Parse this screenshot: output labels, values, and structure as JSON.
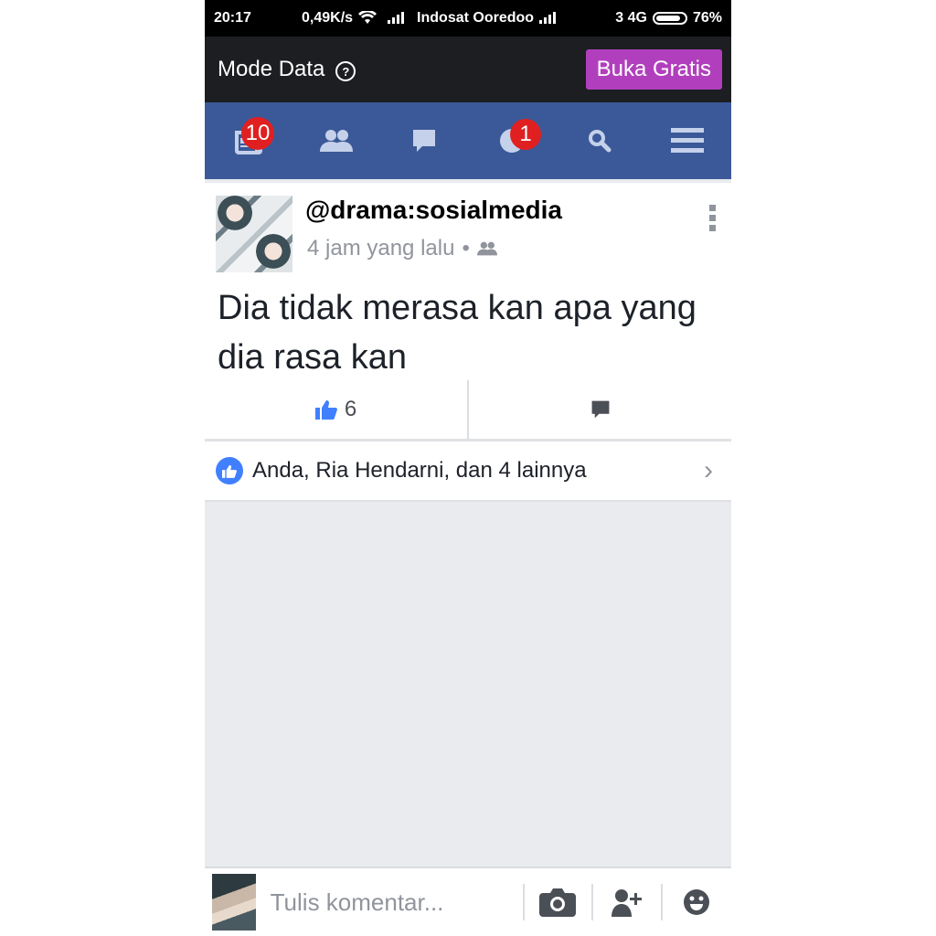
{
  "status_bar": {
    "time": "20:17",
    "speed": "0,49K/s",
    "carrier": "Indosat Ooredoo",
    "network": "3 4G",
    "battery": "76%"
  },
  "mode_bar": {
    "title": "Mode Data",
    "help_glyph": "?",
    "free_button": "Buka Gratis"
  },
  "nav": {
    "news_badge": "10",
    "notifications_badge": "1"
  },
  "post": {
    "author": "@drama:sosialmedia",
    "time": "4 jam yang lalu",
    "separator": "•",
    "text": "Dia tidak merasa kan apa yang dia rasa kan",
    "likes_count": "6"
  },
  "likes_row": {
    "text": "Anda, Ria Hendarni, dan 4 lainnya",
    "chevron": "›"
  },
  "comment_bar": {
    "placeholder": "Tulis komentar..."
  },
  "colors": {
    "fb_blue": "#3b5998",
    "free_button": "#b13fbd",
    "badge_red": "#e02020",
    "like_blue": "#4080ff"
  }
}
